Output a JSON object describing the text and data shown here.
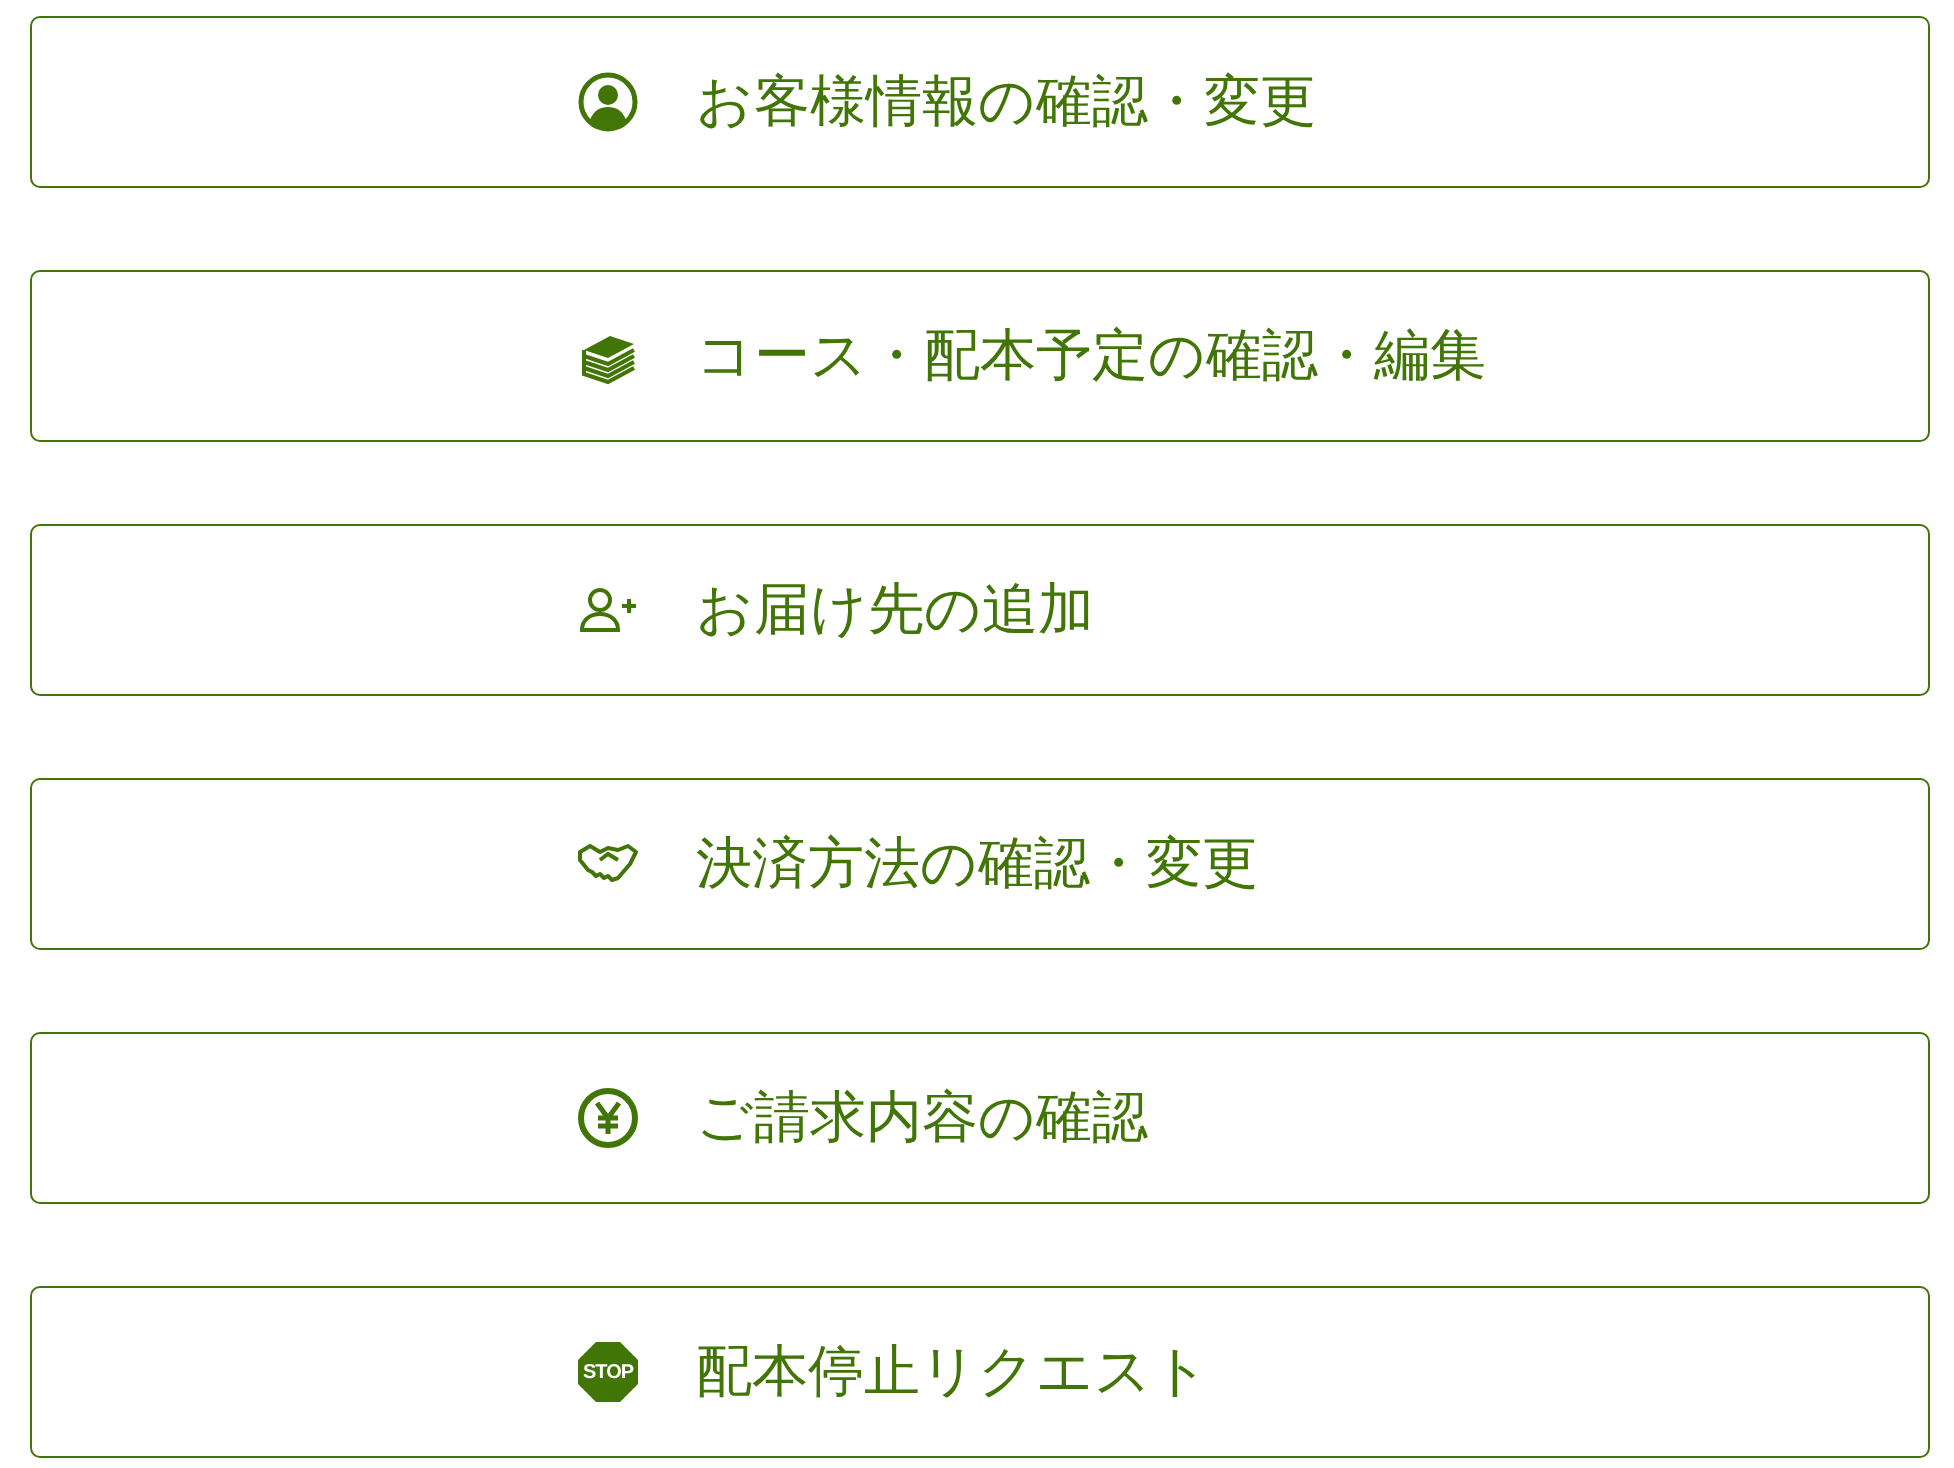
{
  "menu": [
    {
      "kind": "person",
      "label": "お客様情報の確認・変更"
    },
    {
      "kind": "books",
      "label": "コース・配本予定の確認・編集"
    },
    {
      "kind": "person-add",
      "label": "お届け先の追加"
    },
    {
      "kind": "handshake",
      "label": "決済方法の確認・変更"
    },
    {
      "kind": "yen",
      "label": "ご請求内容の確認"
    },
    {
      "kind": "stop",
      "label": "配本停止リクエスト",
      "icon_text": "STOP"
    }
  ]
}
